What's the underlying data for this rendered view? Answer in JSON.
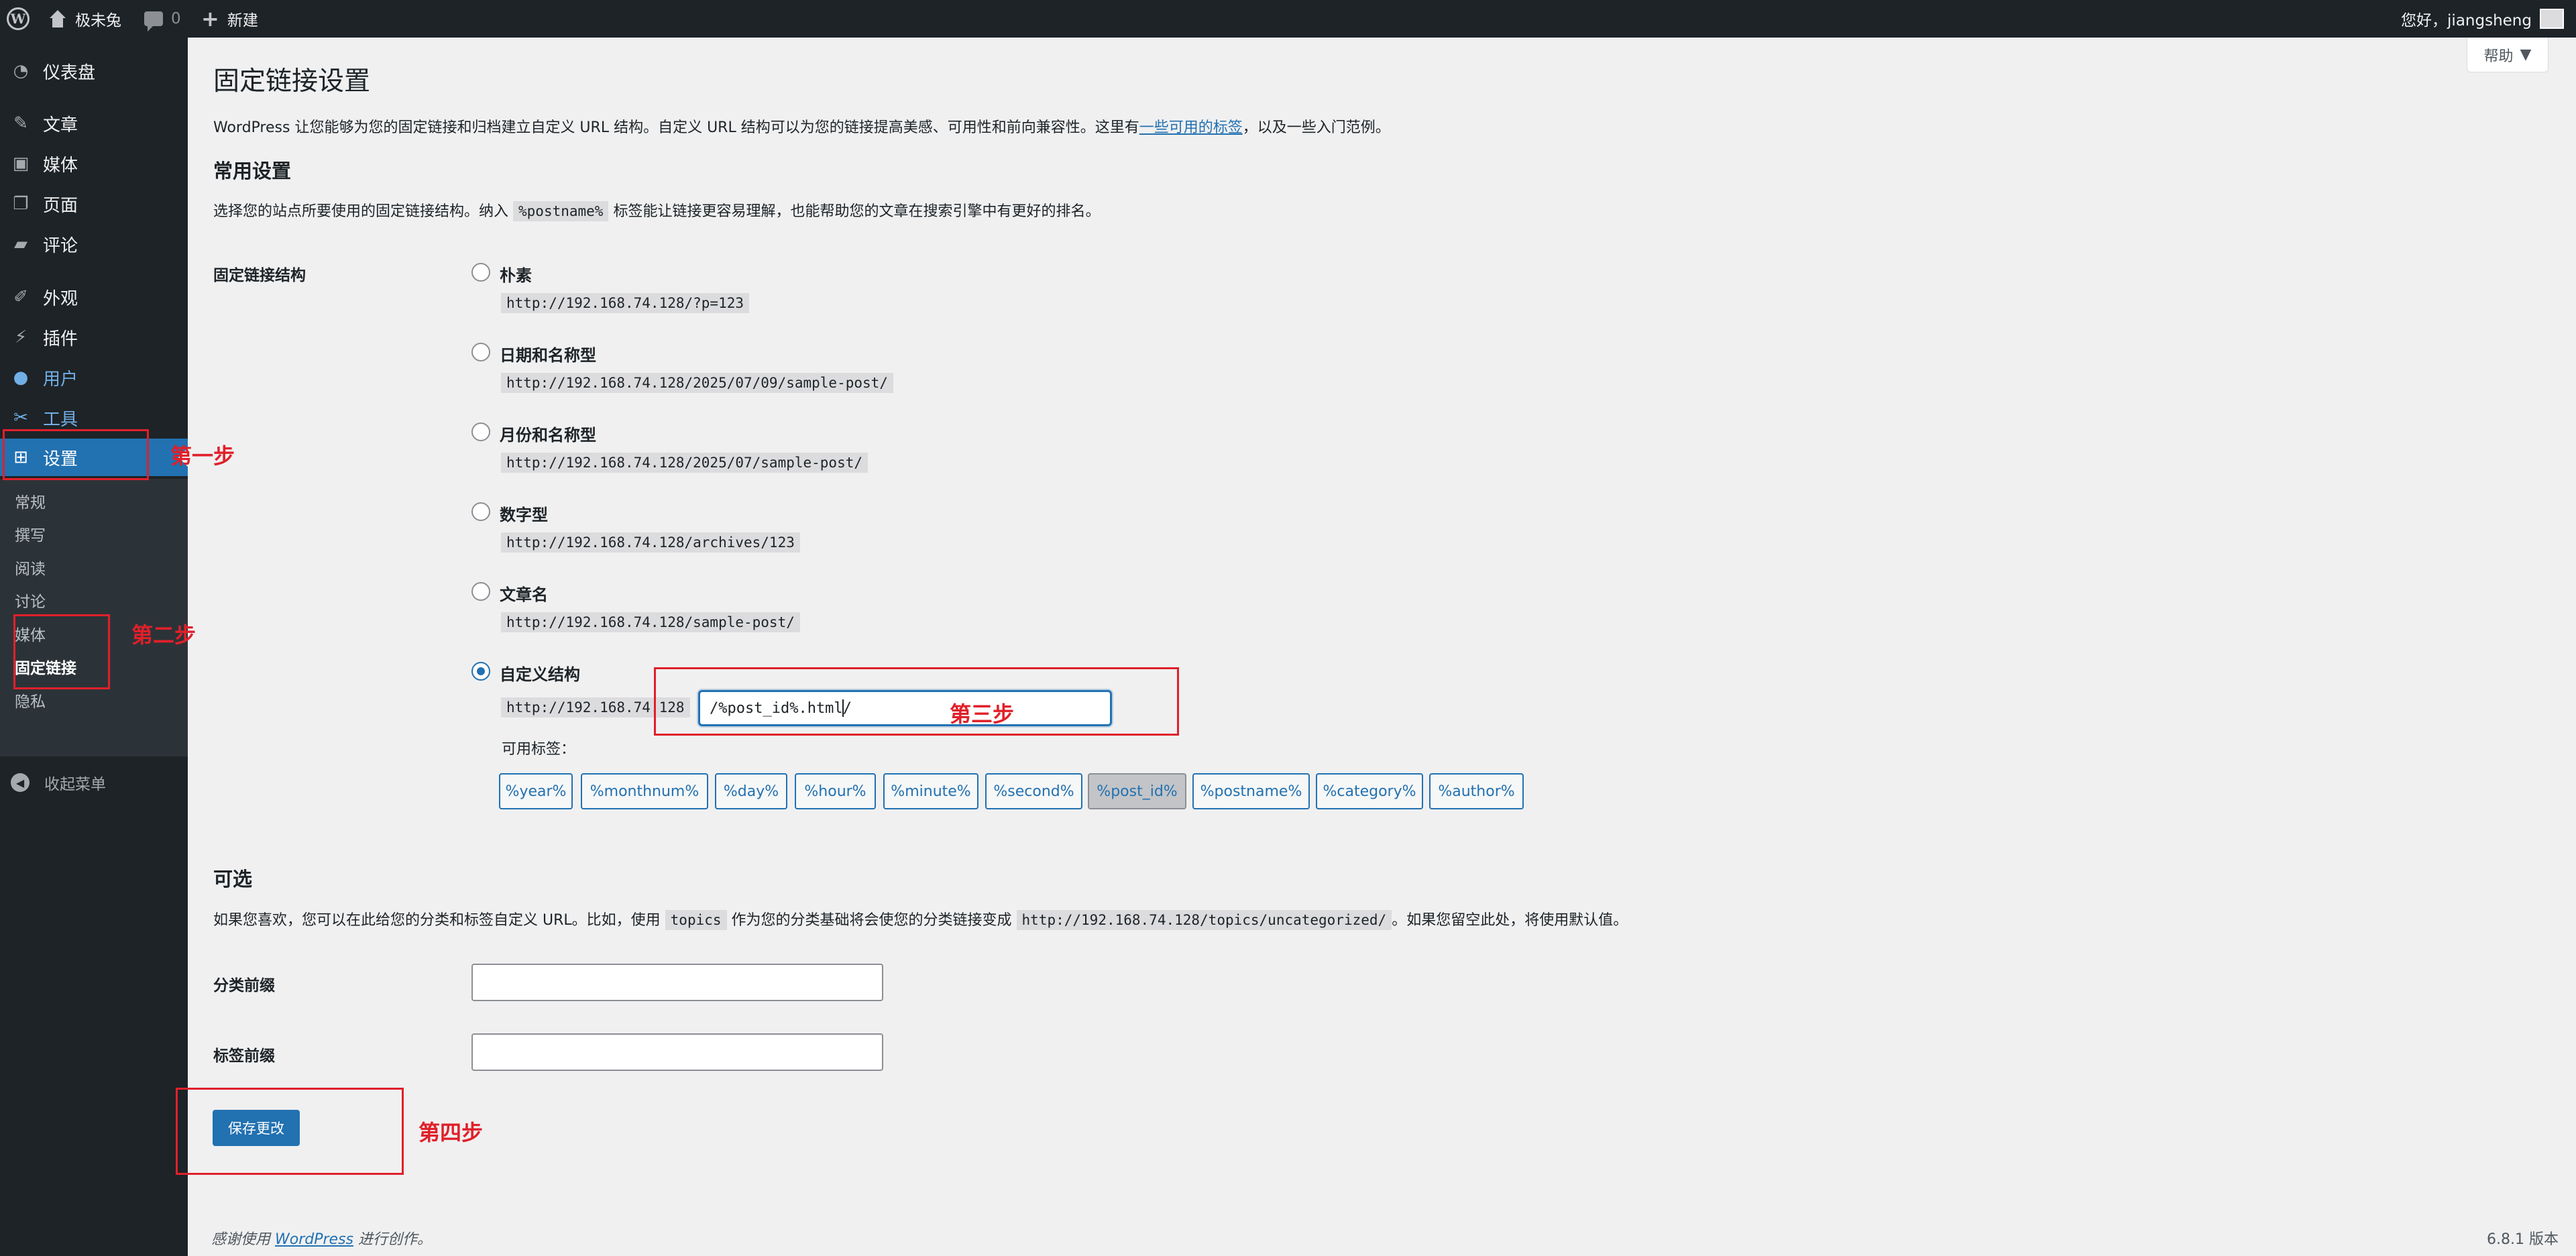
{
  "adminbar": {
    "site_name": "极未兔",
    "comment_count": "0",
    "new_label": "新建",
    "greeting": "您好，jiangsheng"
  },
  "sidebar": {
    "items": [
      {
        "label": "仪表盘",
        "icon": "dashboard-icon"
      },
      {
        "label": "文章",
        "icon": "pin-icon"
      },
      {
        "label": "媒体",
        "icon": "media-icon"
      },
      {
        "label": "页面",
        "icon": "page-icon"
      },
      {
        "label": "评论",
        "icon": "comment-icon"
      },
      {
        "label": "外观",
        "icon": "brush-icon"
      },
      {
        "label": "插件",
        "icon": "plugin-icon"
      },
      {
        "label": "用户",
        "icon": "user-icon"
      },
      {
        "label": "工具",
        "icon": "wrench-icon"
      },
      {
        "label": "设置",
        "icon": "settings-icon"
      }
    ],
    "submenu": [
      "常规",
      "撰写",
      "阅读",
      "讨论",
      "媒体",
      "固定链接",
      "隐私"
    ],
    "collapse_label": "收起菜单"
  },
  "help_label": "帮助",
  "main": {
    "title": "固定链接设置",
    "intro_before": "WordPress 让您能够为您的固定链接和归档建立自定义 URL 结构。自定义 URL 结构可以为您的链接提高美感、可用性和前向兼容性。这里有",
    "intro_link": "一些可用的标签",
    "intro_after": "，以及一些入门范例。",
    "common_heading": "常用设置",
    "common_desc_before": "选择您的站点所要使用的固定链接结构。纳入",
    "common_desc_code": "%postname%",
    "common_desc_after": "标签能让链接更容易理解，也能帮助您的文章在搜索引擎中有更好的排名。",
    "structure_label": "固定链接结构",
    "options": [
      {
        "label": "朴素",
        "example": "http://192.168.74.128/?p=123"
      },
      {
        "label": "日期和名称型",
        "example": "http://192.168.74.128/2025/07/09/sample-post/"
      },
      {
        "label": "月份和名称型",
        "example": "http://192.168.74.128/2025/07/sample-post/"
      },
      {
        "label": "数字型",
        "example": "http://192.168.74.128/archives/123"
      },
      {
        "label": "文章名",
        "example": "http://192.168.74.128/sample-post/"
      }
    ],
    "custom": {
      "label": "自定义结构",
      "prefix": "http://192.168.74.128",
      "value_before_caret": "/%post_id%.html",
      "value_after_caret": "/"
    },
    "available_tags_label": "可用标签：",
    "tags": [
      "%year%",
      "%monthnum%",
      "%day%",
      "%hour%",
      "%minute%",
      "%second%",
      "%post_id%",
      "%postname%",
      "%category%",
      "%author%"
    ],
    "optional_heading": "可选",
    "optional_desc_before": "如果您喜欢，您可以在此给您的分类和标签自定义 URL。比如，使用",
    "optional_desc_code1": "topics",
    "optional_desc_mid": "作为您的分类基础将会使您的分类链接变成",
    "optional_desc_code2": "http://192.168.74.128/topics/uncategorized/",
    "optional_desc_after": "。如果您留空此处，将使用默认值。",
    "category_base_label": "分类前缀",
    "tag_base_label": "标签前缀",
    "save_label": "保存更改"
  },
  "footer": {
    "thanks_before": "感谢使用",
    "thanks_link": "WordPress",
    "thanks_after": "进行创作。",
    "version": "6.8.1 版本"
  },
  "annotations": {
    "step1": "第一步",
    "step2": "第二步",
    "step3": "第三步",
    "step4": "第四步",
    "color": "#e0202a"
  },
  "colors": {
    "accent": "#2271b1",
    "sidebar_bg": "#1d2327",
    "submenu_bg": "#2c3338",
    "page_bg": "#f0f0f1"
  }
}
